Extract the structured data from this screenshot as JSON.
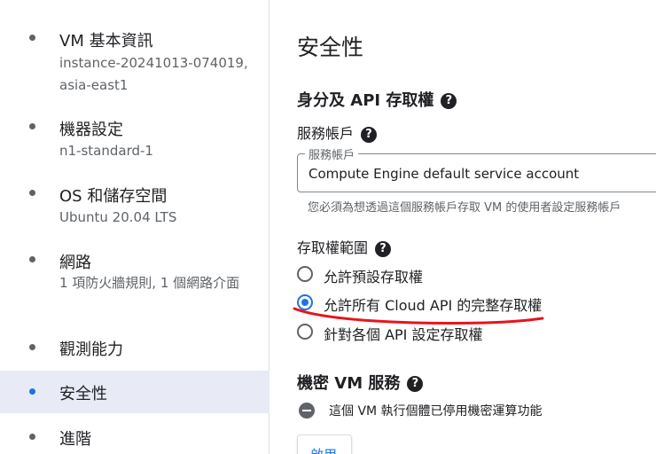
{
  "sidebar": {
    "items": [
      {
        "title": "VM 基本資訊",
        "subtitle": "instance-20241013-074019, asia-east1",
        "active": false
      },
      {
        "title": "機器設定",
        "subtitle": "n1-standard-1",
        "active": false
      },
      {
        "title": "OS 和儲存空間",
        "subtitle": "Ubuntu 20.04 LTS",
        "active": false
      },
      {
        "title": "網路",
        "subtitle": "1 項防火牆規則, 1 個網路介面",
        "active": false
      },
      {
        "title": "觀測能力",
        "subtitle": "",
        "active": false
      },
      {
        "title": "安全性",
        "subtitle": "",
        "active": true
      },
      {
        "title": "進階",
        "subtitle": "",
        "active": false
      }
    ]
  },
  "main": {
    "page_title": "安全性",
    "identity_section": {
      "title": "身分及 API 存取權",
      "service_account_label": "服務帳戶",
      "service_account_field_label": "服務帳戶",
      "service_account_value": "Compute Engine default service account",
      "service_account_hint": "您必須為想透過這個服務帳戶存取 VM 的使用者設定服務帳戶",
      "access_scope_label": "存取權範圍",
      "access_scope_options": [
        {
          "label": "允許預設存取權",
          "checked": false
        },
        {
          "label": "允許所有 Cloud API 的完整存取權",
          "checked": true
        },
        {
          "label": "針對各個 API 設定存取權",
          "checked": false
        }
      ]
    },
    "confidential_section": {
      "title": "機密 VM 服務",
      "status_text": "這個 VM 執行個體已停用機密運算功能",
      "apply_label": "啟用"
    },
    "help_glyph": "?"
  },
  "colors": {
    "accent": "#1a73e8",
    "active_bg": "#e8eaf6",
    "annotation_red": "#e8141c"
  }
}
